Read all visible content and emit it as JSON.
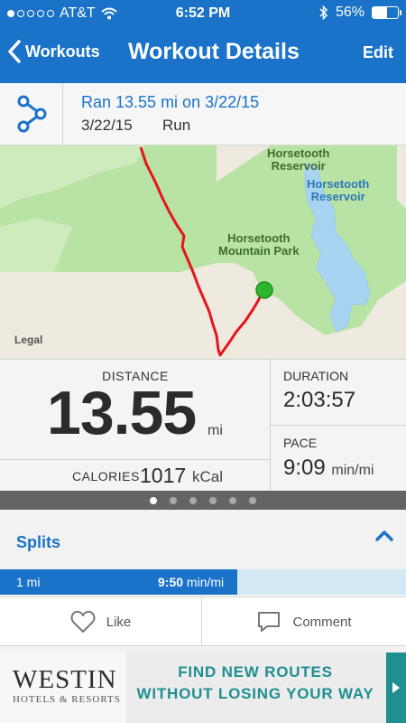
{
  "status_bar": {
    "carrier": "AT&T",
    "signal_bars_filled": 1,
    "signal_bars_total": 5,
    "time": "6:52 PM",
    "battery": "56%",
    "battery_level": 0.56
  },
  "nav": {
    "back_label": "Workouts",
    "title": "Workout Details",
    "edit_label": "Edit"
  },
  "workout": {
    "title": "Ran 13.55 mi on 3/22/15",
    "date": "3/22/15",
    "type": "Run"
  },
  "map": {
    "labels": {
      "reservoir_green": "Horsetooth\nReservoir",
      "reservoir_blue": "Horsetooth\nReservoir",
      "park": "Horsetooth\nMountain Park"
    },
    "legal": "Legal",
    "route_color": "#e8141c",
    "endpoint_color": "#2db52d"
  },
  "stats": {
    "distance_label": "DISTANCE",
    "distance_value": "13.55",
    "distance_unit": "mi",
    "calories_label": "CALORIES",
    "calories_value": "1017",
    "calories_unit": "kCal",
    "duration_label": "DURATION",
    "duration_value": "2:03:57",
    "pace_label": "PACE",
    "pace_value": "9:09",
    "pace_unit": "min/mi"
  },
  "pager": {
    "count": 6,
    "active_index": 0
  },
  "splits": {
    "title": "Splits",
    "rows": [
      {
        "mile": "1 mi",
        "pace": "9:50",
        "unit": "min/mi",
        "bar_fraction": 0.585
      }
    ]
  },
  "actions": {
    "like_label": "Like",
    "comment_label": "Comment"
  },
  "ad": {
    "brand": "WESTIN",
    "brand_sub": "HOTELS & RESORTS",
    "line1": "FIND NEW ROUTES",
    "line2": "WITHOUT LOSING YOUR WAY"
  },
  "colors": {
    "accent": "#1a73c8",
    "ad_teal": "#1f8f92"
  }
}
